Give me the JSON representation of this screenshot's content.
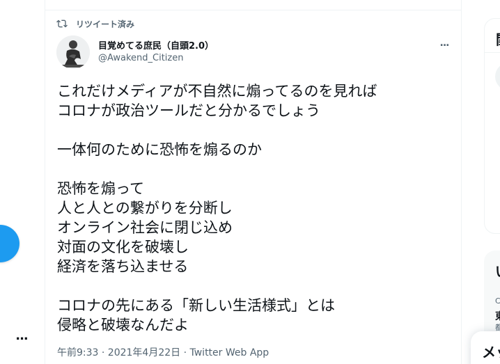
{
  "colors": {
    "accent": "#1d9bf0",
    "text_primary": "#0f1419",
    "text_secondary": "#536471",
    "divider": "#eff3f4"
  },
  "nav": {
    "more_label": "..."
  },
  "tweet": {
    "retweet_label": "リツイート済み",
    "display_name": "目覚めてる庶民（自頭2.0）",
    "handle": "@Awakend_Citizen",
    "more_label": "...",
    "lines": [
      "これだけメディアが不自然に煽ってるのを見れば",
      "コロナが政治ツールだと分かるでしょう",
      "",
      "一体何のために恐怖を煽るのか",
      "",
      "恐怖を煽って",
      "人と人との繋がりを分断し",
      "オンライン社会に閉じ込め",
      "対面の文化を破壊し",
      "経済を落ち込ませる",
      "",
      "コロナの先にある「新しい生活様式」とは",
      "侵略と破壊なんだよ"
    ],
    "meta": "午前9:33 · 2021年4月22日 · Twitter Web App"
  },
  "right": {
    "card_heading": "関",
    "trends_heading": "い",
    "trend_small_1": "C",
    "trend_bold_1": "東",
    "trend_small_2": "都"
  },
  "messages": {
    "title": "メッ"
  }
}
